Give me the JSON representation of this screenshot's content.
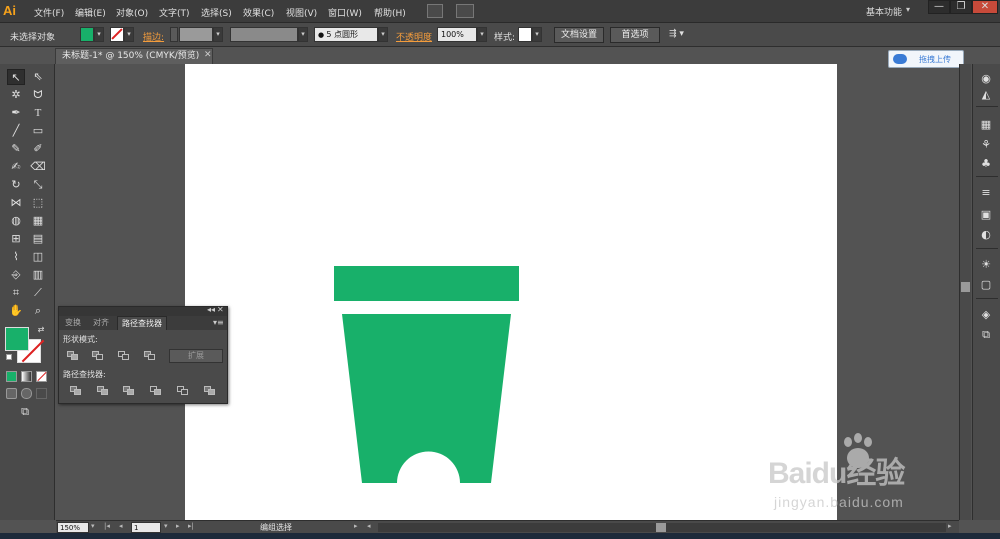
{
  "app": {
    "logo": "Ai"
  },
  "menu": [
    "文件(F)",
    "编辑(E)",
    "对象(O)",
    "文字(T)",
    "选择(S)",
    "效果(C)",
    "视图(V)",
    "窗口(W)",
    "帮助(H)"
  ],
  "workspace": {
    "label": "基本功能",
    "arrow": "▾"
  },
  "window_controls": {
    "minimize": "—",
    "restore": "❐",
    "close": "✕"
  },
  "controlbar": {
    "selection_label": "未选择对象",
    "fill_color": "#18b06a",
    "stroke_label": "描边:",
    "brush_value": "5 点圆形",
    "opacity_label": "不透明度",
    "opacity_value": "100%",
    "style_label": "样式:",
    "doc_settings": "文档设置",
    "preferences": "首选项"
  },
  "document": {
    "tab_title": "未标题-1* @ 150% (CMYK/预览)",
    "close": "✕"
  },
  "upload": {
    "label": "拖拽上传"
  },
  "panel": {
    "tabs": [
      "变换",
      "对齐",
      "路径查找器"
    ],
    "shape_modes_label": "形状模式:",
    "expand_label": "扩展",
    "pathfinders_label": "路径查找器:"
  },
  "artwork": {
    "color": "#18b06a"
  },
  "statusbar": {
    "zoom": "150%",
    "page": "1",
    "status": "编组选择"
  },
  "watermark": {
    "main": "Baidu经验",
    "sub": "jingyan.baidu.com"
  },
  "colors": {
    "accent_orange": "#f39c3c",
    "artwork_green": "#18b06a",
    "upload_blue": "#3a7bd5"
  }
}
